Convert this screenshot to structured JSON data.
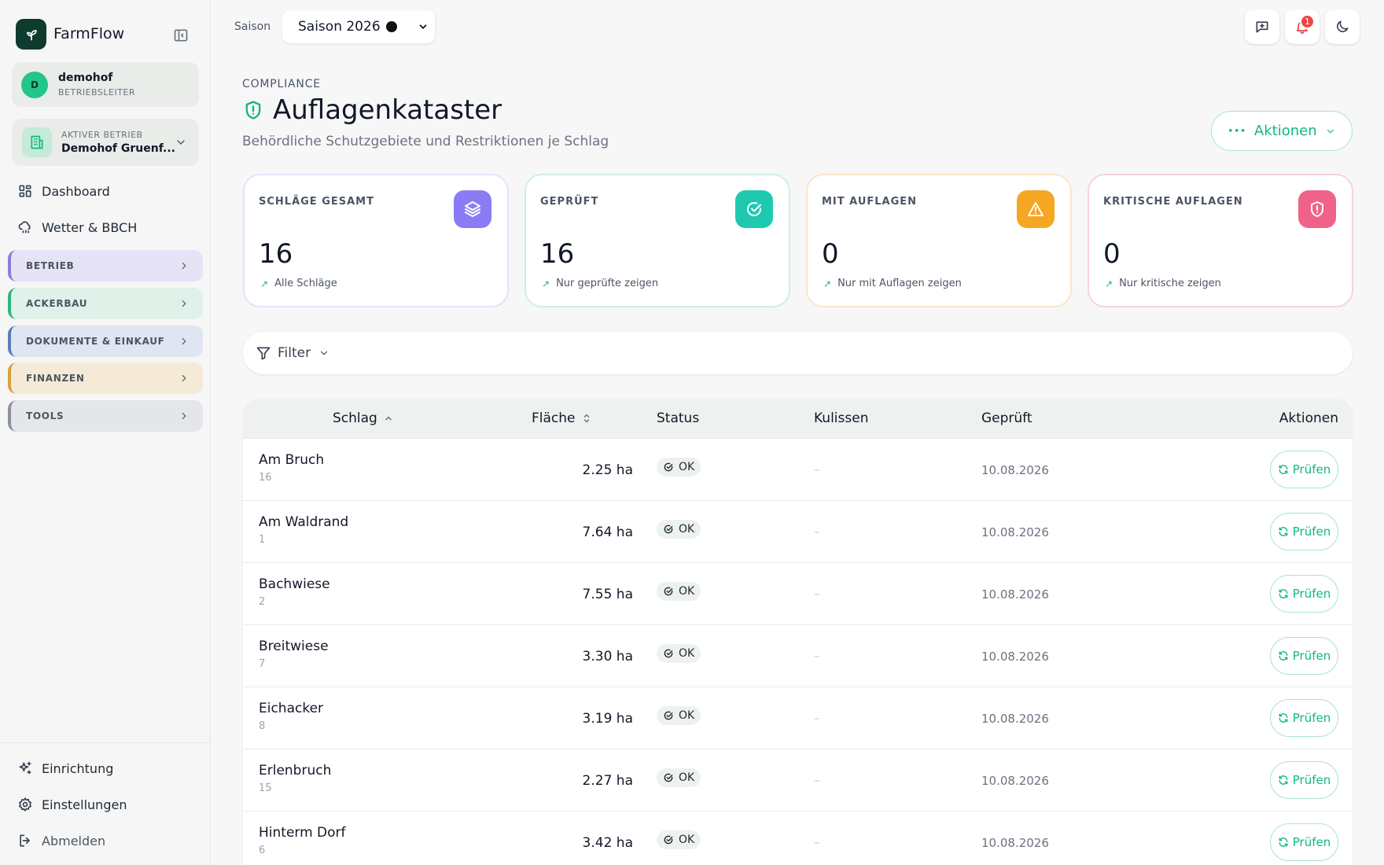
{
  "app": {
    "name": "FarmFlow"
  },
  "user": {
    "initial": "D",
    "name": "demohof",
    "role": "BETRIEBSLEITER"
  },
  "farm": {
    "label": "AKTIVER BETRIEB",
    "name": "Demohof Gruenf..."
  },
  "nav": {
    "dashboard": "Dashboard",
    "weather": "Wetter & BBCH",
    "groups": [
      {
        "label": "BETRIEB",
        "bg": "#e7e3f6",
        "border": "#8b7fd8"
      },
      {
        "label": "ACKERBAU",
        "bg": "#dff1e8",
        "border": "#34b37e"
      },
      {
        "label": "DOKUMENTE & EINKAUF",
        "bg": "#dfe6f1",
        "border": "#5a7fb8"
      },
      {
        "label": "FINANZEN",
        "bg": "#f5ead6",
        "border": "#d9a03c"
      },
      {
        "label": "TOOLS",
        "bg": "#e4e6e9",
        "border": "#8c929a"
      }
    ],
    "setup": "Einrichtung",
    "settings": "Einstellungen",
    "logout": "Abmelden"
  },
  "topbar": {
    "season_label": "Saison",
    "season_value": "Saison 2026",
    "notification_count": "1"
  },
  "header": {
    "eyebrow": "COMPLIANCE",
    "title": "Auflagenkataster",
    "subtitle": "Behördliche Schutzgebiete und Restriktionen je Schlag",
    "actions": "Aktionen"
  },
  "stats": [
    {
      "label": "SCHLÄGE GESAMT",
      "value": "16",
      "link": "Alle Schläge",
      "color": "#8b7cf6",
      "border": "#e6e2fb"
    },
    {
      "label": "GEPRÜFT",
      "value": "16",
      "link": "Nur geprüfte zeigen",
      "color": "#1fc9b0",
      "border": "#cdeee6"
    },
    {
      "label": "MIT AUFLAGEN",
      "value": "0",
      "link": "Nur mit Auflagen zeigen",
      "color": "#f5a623",
      "border": "#f8e7c8"
    },
    {
      "label": "KRITISCHE AUFLAGEN",
      "value": "0",
      "link": "Nur kritische zeigen",
      "color": "#f0628a",
      "border": "#f7d3dc"
    }
  ],
  "filter": {
    "label": "Filter"
  },
  "table": {
    "headers": {
      "name": "Schlag",
      "area": "Fläche",
      "status": "Status",
      "kulissen": "Kulissen",
      "checked": "Geprüft",
      "actions": "Aktionen"
    },
    "rows": [
      {
        "name": "Am Bruch",
        "num": "16",
        "area": "2.25 ha",
        "status": "OK",
        "kulissen": "–",
        "date": "10.08.2026",
        "action": "Prüfen"
      },
      {
        "name": "Am Waldrand",
        "num": "1",
        "area": "7.64 ha",
        "status": "OK",
        "kulissen": "–",
        "date": "10.08.2026",
        "action": "Prüfen"
      },
      {
        "name": "Bachwiese",
        "num": "2",
        "area": "7.55 ha",
        "status": "OK",
        "kulissen": "–",
        "date": "10.08.2026",
        "action": "Prüfen"
      },
      {
        "name": "Breitwiese",
        "num": "7",
        "area": "3.30 ha",
        "status": "OK",
        "kulissen": "–",
        "date": "10.08.2026",
        "action": "Prüfen"
      },
      {
        "name": "Eichacker",
        "num": "8",
        "area": "3.19 ha",
        "status": "OK",
        "kulissen": "–",
        "date": "10.08.2026",
        "action": "Prüfen"
      },
      {
        "name": "Erlenbruch",
        "num": "15",
        "area": "2.27 ha",
        "status": "OK",
        "kulissen": "–",
        "date": "10.08.2026",
        "action": "Prüfen"
      },
      {
        "name": "Hinterm Dorf",
        "num": "6",
        "area": "3.42 ha",
        "status": "OK",
        "kulissen": "–",
        "date": "10.08.2026",
        "action": "Prüfen"
      }
    ]
  }
}
